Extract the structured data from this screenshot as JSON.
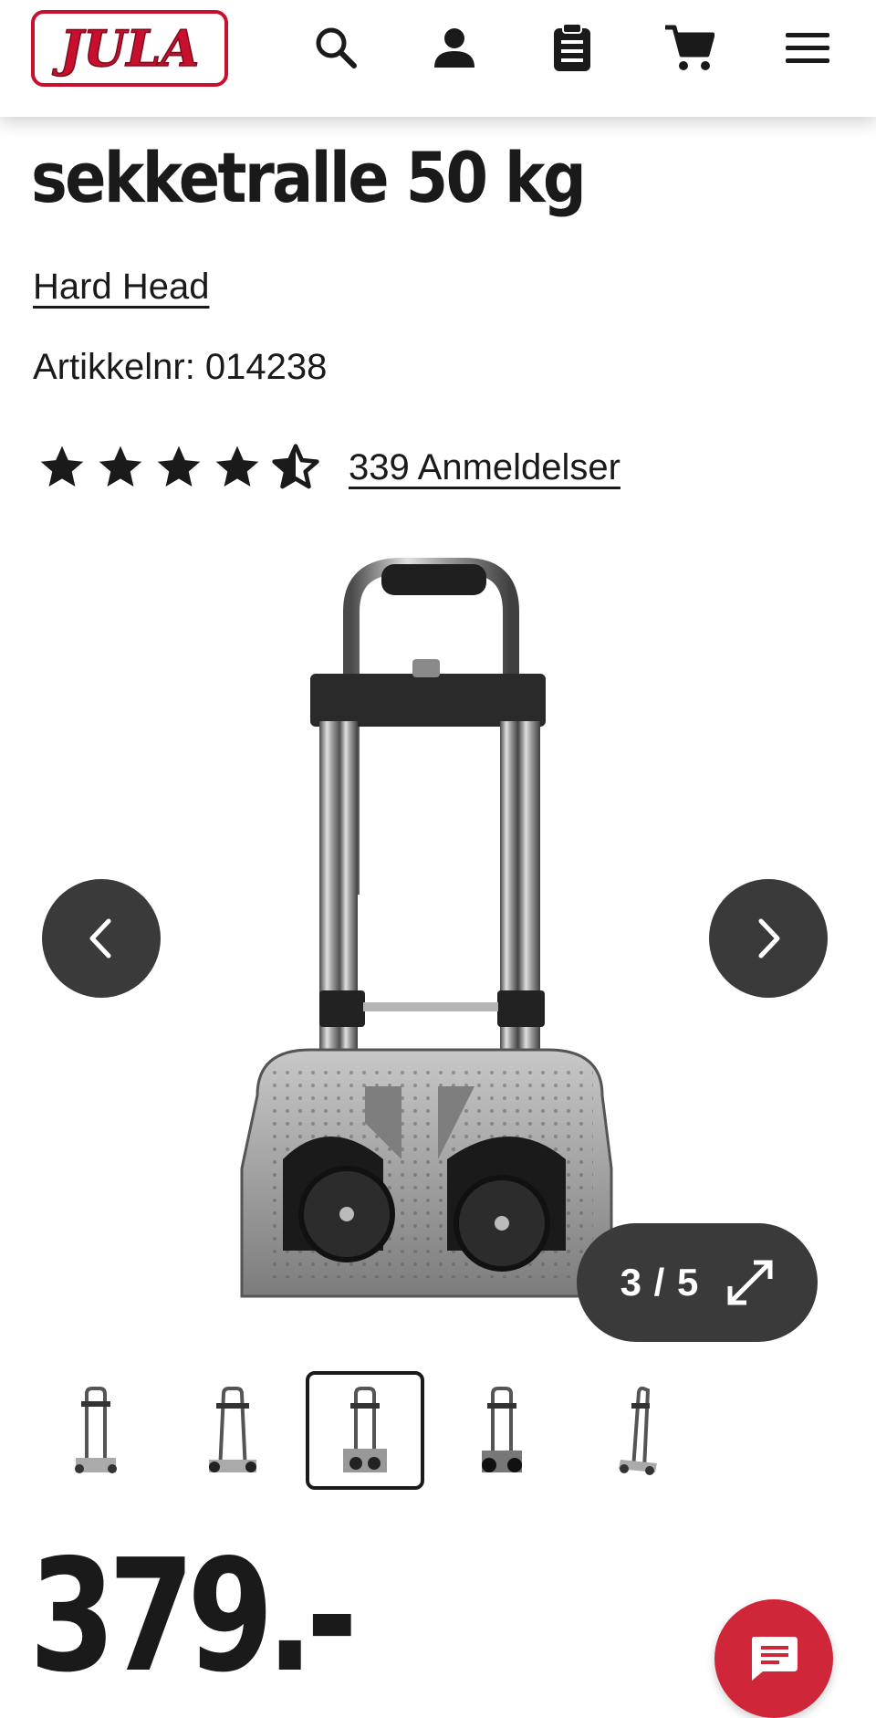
{
  "header": {
    "logo_text": "JULA",
    "brand_color": "#c8102e",
    "icons": [
      "search-icon",
      "user-icon",
      "shopping-list-icon",
      "cart-icon",
      "menu-icon"
    ]
  },
  "product": {
    "title": "sekketralle 50 kg",
    "brand": "Hard Head",
    "article_number": "Artikkelnr: 014238",
    "rating": 4.5,
    "rating_max": 5,
    "reviews_label": "339 Anmeldelser",
    "price": "379.-"
  },
  "gallery": {
    "counter": "3 / 5",
    "current_index": 3,
    "total": 5,
    "thumbnail_count": 5,
    "selected_thumbnail": 3
  },
  "chat": {
    "icon": "chat-icon",
    "color": "#d0263a"
  }
}
